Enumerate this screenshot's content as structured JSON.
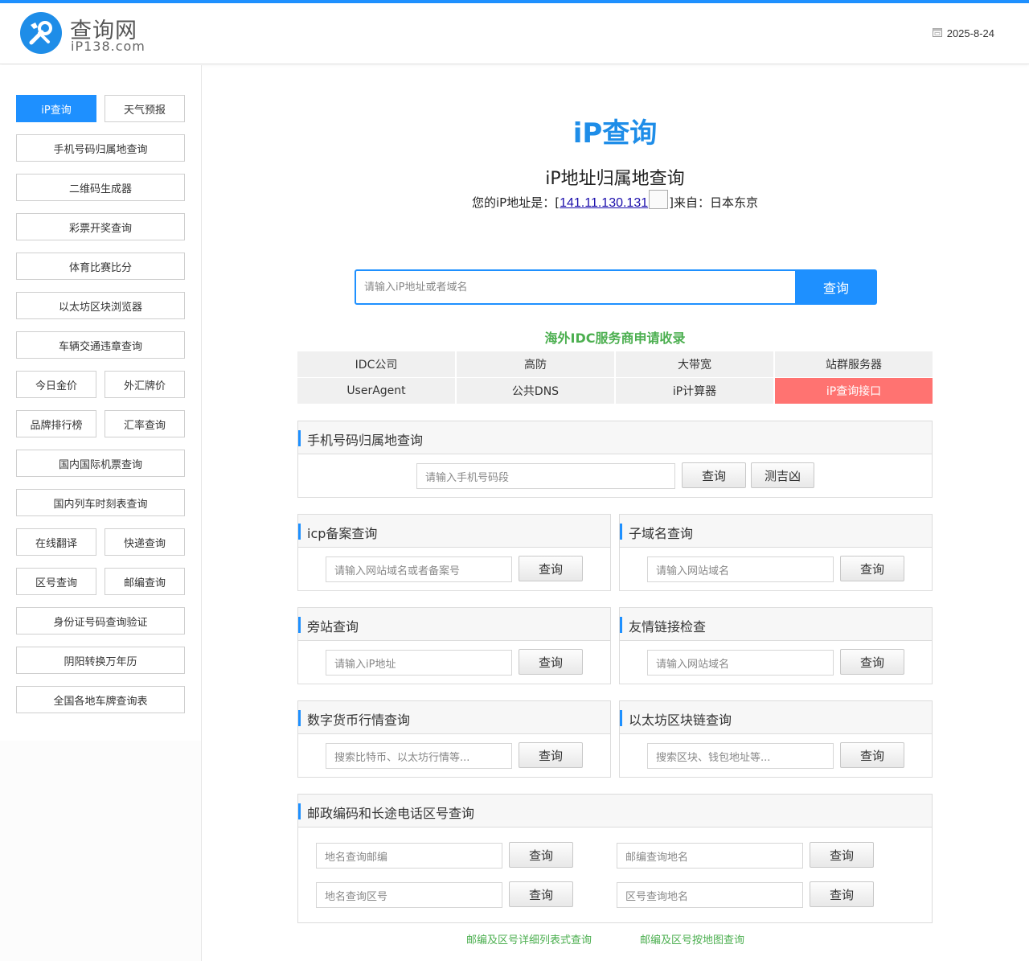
{
  "header": {
    "logo_cn": "查询网",
    "logo_en": "iP138.com",
    "date": "2025-8-24",
    "icon": "calendar-icon"
  },
  "sidebar": {
    "items": [
      "iP查询",
      "天气预报",
      "手机号码归属地查询",
      "二维码生成器",
      "彩票开奖查询",
      "体育比赛比分",
      "以太坊区块浏览器",
      "车辆交通违章查询",
      "今日金价",
      "外汇牌价",
      "品牌排行榜",
      "汇率查询",
      "国内国际机票查询",
      "国内列车时刻表查询",
      "在线翻译",
      "快递查询",
      "区号查询",
      "邮编查询",
      "身份证号码查询验证",
      "阴阳转换万年历",
      "全国各地车牌查询表"
    ],
    "active_color": "#1e90ff"
  },
  "main": {
    "title": "iP查询",
    "subtitle": "iP地址归属地查询",
    "ip_prefix": "您的iP地址是：[",
    "ip": "141.11.130.131",
    "ip_suffix": "]来自：日本东京",
    "search_placeholder": "请输入iP地址或者域名",
    "search_button": "查询",
    "idc_title": "海外IDC服务商申请收录",
    "quick_links": [
      "IDC公司",
      "高防",
      "大带宽",
      "站群服务器",
      "UserAgent",
      "公共DNS",
      "iP计算器",
      "iP查询接口"
    ],
    "hot_color": "#ff7371"
  },
  "panels": {
    "phone": {
      "title": "手机号码归属地查询",
      "placeholder": "请输入手机号码段",
      "btn": "查询",
      "btn2": "测吉凶"
    },
    "icp": {
      "title": "icp备案查询",
      "placeholder": "请输入网站域名或者备案号",
      "btn": "查询"
    },
    "subdomain": {
      "title": "子域名查询",
      "placeholder": "请输入网站域名",
      "btn": "查询"
    },
    "sidesite": {
      "title": "旁站查询",
      "placeholder": "请输入iP地址",
      "btn": "查询"
    },
    "friendlink": {
      "title": "友情链接检查",
      "placeholder": "请输入网站域名",
      "btn": "查询"
    },
    "crypto": {
      "title": "数字货币行情查询",
      "placeholder": "搜索比特币、以太坊行情等...",
      "btn": "查询"
    },
    "eth": {
      "title": "以太坊区块链查询",
      "placeholder": "搜索区块、钱包地址等...",
      "btn": "查询"
    },
    "postal": {
      "title": "邮政编码和长途电话区号查询",
      "ph1": "地名查询邮编",
      "ph2": "邮编查询地名",
      "ph3": "地名查询区号",
      "ph4": "区号查询地名",
      "btn": "查询",
      "link1": "邮编及区号详细列表式查询",
      "link2": "邮编及区号按地图查询"
    }
  }
}
